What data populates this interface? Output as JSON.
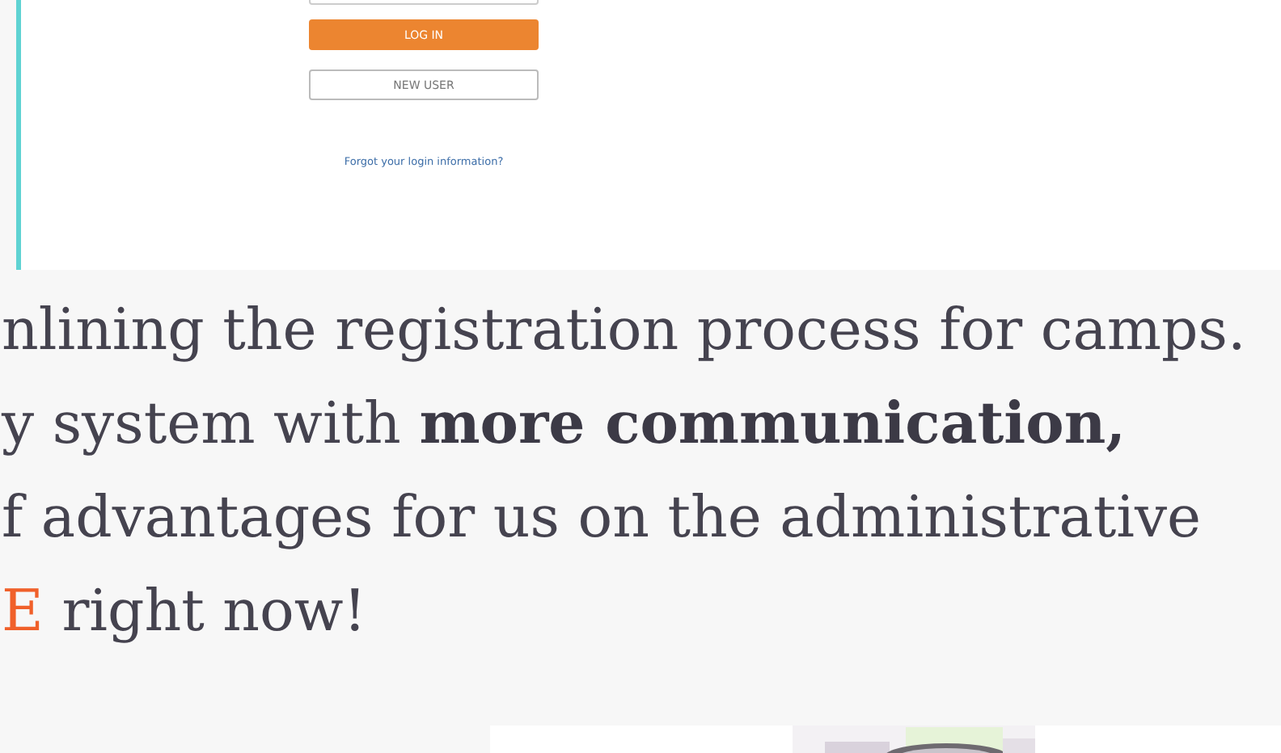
{
  "login_screenshot": {
    "buttons": [
      {
        "label": "LOG IN",
        "kind": "primary"
      },
      {
        "label": "NEW USER",
        "kind": "secondary"
      }
    ],
    "forgot_link": "Forgot your login information?"
  },
  "paragraph": {
    "lines": [
      "nlining the registration process for camps.",
      "y system with **more communication,**",
      "f advantages for us on the administrative"
    ],
    "link": "E",
    "after_link": " right now!"
  }
}
